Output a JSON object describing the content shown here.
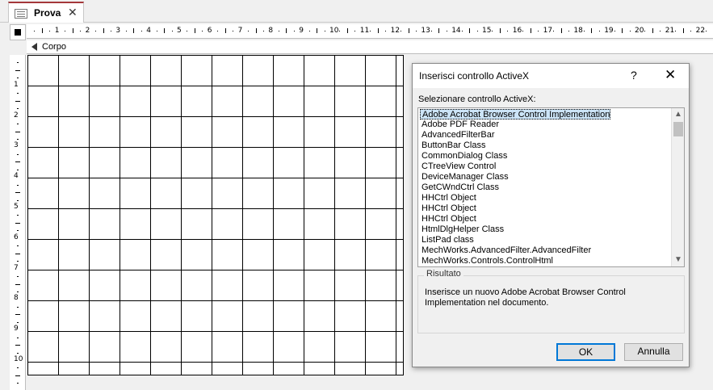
{
  "tab": {
    "label": "Prova",
    "close": "✕"
  },
  "section": {
    "label": "Corpo"
  },
  "hruler_numbers": [
    "1",
    "2",
    "3",
    "4",
    "5",
    "6",
    "7",
    "8",
    "9",
    "10",
    "11",
    "12",
    "13",
    "14",
    "15",
    "16",
    "17",
    "18",
    "19",
    "20",
    "21",
    "22"
  ],
  "vruler_numbers": [
    "1",
    "2",
    "3",
    "4",
    "5",
    "6",
    "7",
    "8",
    "9",
    "10"
  ],
  "dialog": {
    "title": "Inserisci controllo ActiveX",
    "help": "?",
    "close": "✕",
    "list_label": "Selezionare controllo ActiveX:",
    "items": [
      "Adobe Acrobat Browser Control Implementation",
      "Adobe PDF Reader",
      "AdvancedFilterBar",
      "ButtonBar Class",
      "CommonDialog Class",
      "CTreeView Control",
      "DeviceManager Class",
      "GetCWndCtrl Class",
      "HHCtrl Object",
      "HHCtrl Object",
      "HHCtrl Object",
      "HtmlDlgHelper Class",
      "ListPad class",
      "MechWorks.AdvancedFilter.AdvancedFilter",
      "MechWorks.Controls.ControlHtml"
    ],
    "selected_index": 0,
    "result_legend": "Risultato",
    "result_text": "Inserisce un nuovo Adobe Acrobat Browser Control Implementation nel documento.",
    "ok_label": "OK",
    "cancel_label": "Annulla"
  },
  "colors": {
    "tab_accent": "#a4373a",
    "selection": "#cce4f7",
    "ok_border": "#0078d7"
  }
}
